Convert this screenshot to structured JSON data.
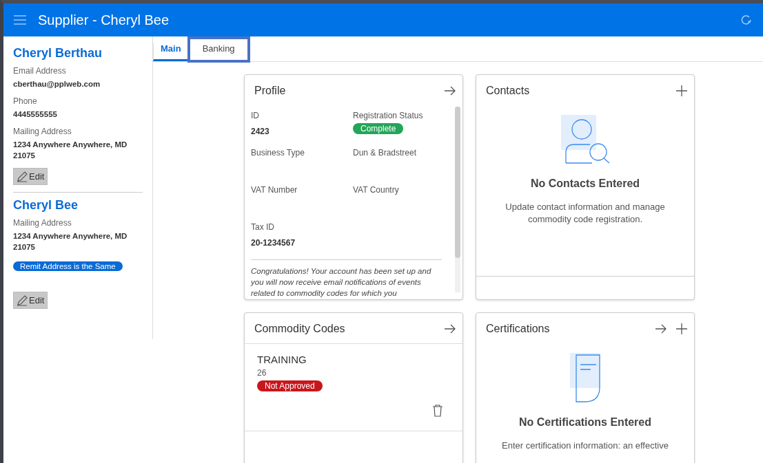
{
  "header": {
    "title": "Supplier - Cheryl Bee"
  },
  "sidebar": {
    "people": [
      {
        "name": "Cheryl Berthau",
        "fields": [
          {
            "label": "Email Address",
            "value": "cberthau@pplweb.com"
          },
          {
            "label": "Phone",
            "value": "4445555555"
          },
          {
            "label": "Mailing Address",
            "value": "1234 Anywhere Anywhere, MD 21075"
          }
        ],
        "edit": "Edit"
      },
      {
        "name": "Cheryl Bee",
        "fields": [
          {
            "label": "Mailing Address",
            "value": "1234 Anywhere Anywhere, MD 21075"
          }
        ],
        "badge": "Remit Address is the Same",
        "edit": "Edit"
      }
    ]
  },
  "tabs": [
    {
      "label": "Main",
      "selected": true,
      "focused": false
    },
    {
      "label": "Banking",
      "selected": false,
      "focused": true
    }
  ],
  "cards": [
    {
      "kind": "profile",
      "title": "Profile",
      "fields": [
        {
          "label": "ID",
          "value": "2423"
        },
        {
          "label": "Registration Status",
          "status": "Complete",
          "complete": true
        },
        {
          "label": "Business Type"
        },
        {
          "label": "Dun & Bradstreet"
        },
        {
          "label": "VAT Number"
        },
        {
          "label": "VAT Country"
        },
        {
          "label": "Tax ID",
          "value": "20-1234567"
        }
      ],
      "note": "Congratulations! Your account has been set up and you will now receive email notifications of events related to commodity codes for which you"
    },
    {
      "kind": "contacts",
      "title": "Contacts",
      "empty_title": "No Contacts Entered",
      "empty_text": "Update contact information and manage commodity code registration."
    },
    {
      "kind": "codes",
      "title": "Commodity Codes",
      "items": [
        {
          "name": "TRAINING",
          "code": "26",
          "status": "Not Approved",
          "approved": false
        }
      ]
    },
    {
      "kind": "certifications",
      "title": "Certifications",
      "empty_title": "No Certifications Entered",
      "empty_text": "Enter certification information: an effective"
    }
  ]
}
